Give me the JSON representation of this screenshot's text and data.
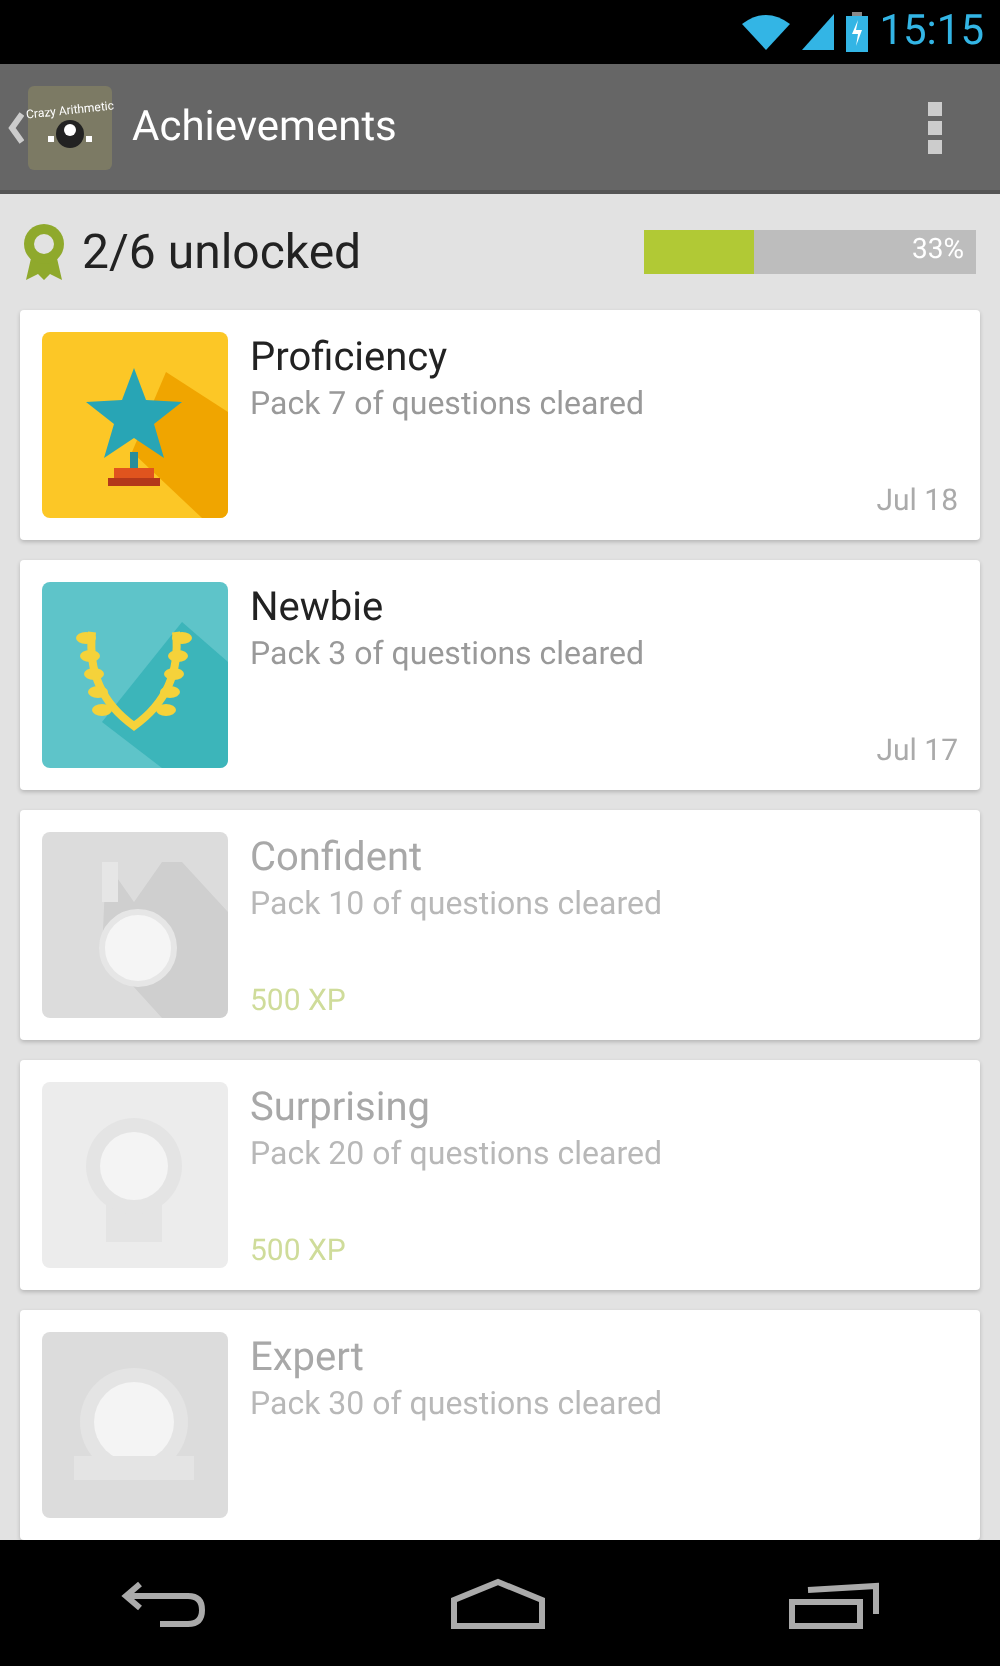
{
  "status_bar": {
    "time": "15:15"
  },
  "action_bar": {
    "app_icon_text": "Crazy Arithmetic",
    "title": "Achievements"
  },
  "summary": {
    "label": "2/6 unlocked",
    "level": 0.33,
    "percent": "33%"
  },
  "achievements": [
    {
      "kind": "star",
      "title": "Proficiency",
      "description": "Pack 7 of questions cleared",
      "date": "Jul 18",
      "unlocked": true
    },
    {
      "kind": "laurel",
      "title": "Newbie",
      "description": "Pack 3 of questions cleared",
      "date": "Jul 17",
      "unlocked": true
    },
    {
      "kind": "medal",
      "title": "Confident",
      "description": "Pack 10 of questions cleared",
      "reward": "500 XP",
      "unlocked": false
    },
    {
      "kind": "rosette",
      "title": "Surprising",
      "description": "Pack 20 of questions cleared",
      "reward": "500 XP",
      "unlocked": false
    },
    {
      "kind": "seal",
      "title": "Expert",
      "description": "Pack 30 of questions cleared",
      "unlocked": false
    }
  ]
}
